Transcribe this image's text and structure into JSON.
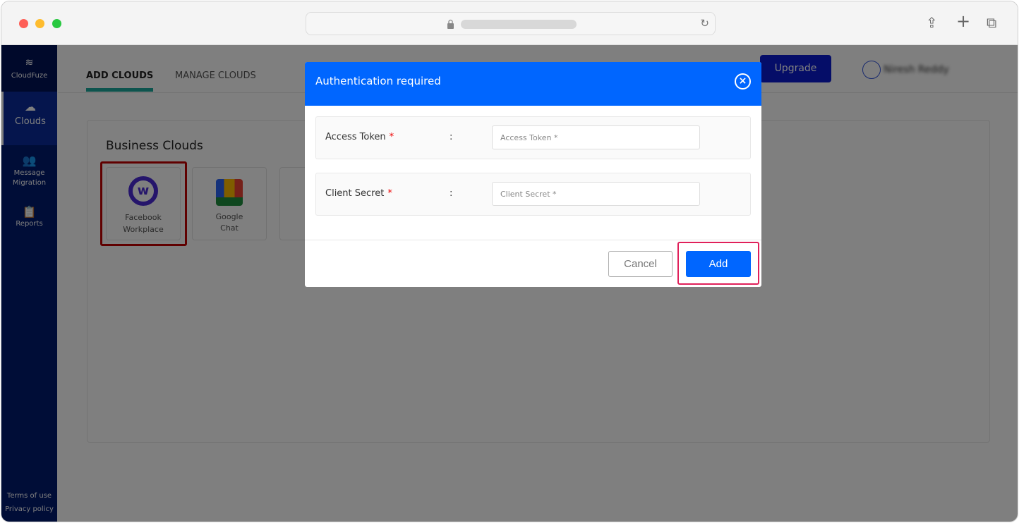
{
  "browser": {
    "share_icon": "share-icon",
    "new_tab_icon": "plus-icon",
    "tabs_icon": "tabs-icon"
  },
  "sidebar": {
    "brand": "CloudFuze",
    "items": [
      {
        "label": "Clouds",
        "icon": "cloud-icon"
      },
      {
        "label": "Message Migration",
        "icon": "users-icon"
      },
      {
        "label": "Reports",
        "icon": "clipboard-icon"
      }
    ],
    "footer": [
      "Terms of use",
      "Privacy policy"
    ]
  },
  "header": {
    "tabs": [
      "ADD CLOUDS",
      "MANAGE CLOUDS"
    ],
    "upgrade": "Upgrade",
    "user": "Niresh Reddy"
  },
  "main": {
    "section_title": "Business Clouds",
    "clouds": [
      "Facebook Workplace",
      "Google Chat"
    ]
  },
  "modal": {
    "title": "Authentication required",
    "fields": [
      {
        "label": "Access Token",
        "required": "*",
        "separator": ":",
        "placeholder": "Access Token *"
      },
      {
        "label": "Client Secret",
        "required": "*",
        "separator": ":",
        "placeholder": "Client Secret *"
      }
    ],
    "cancel": "Cancel",
    "add": "Add"
  },
  "colors": {
    "primary": "#0066ff",
    "sidebar": "#001a6e",
    "highlight": "#e0205a",
    "tab_underline": "#1aa89c"
  }
}
